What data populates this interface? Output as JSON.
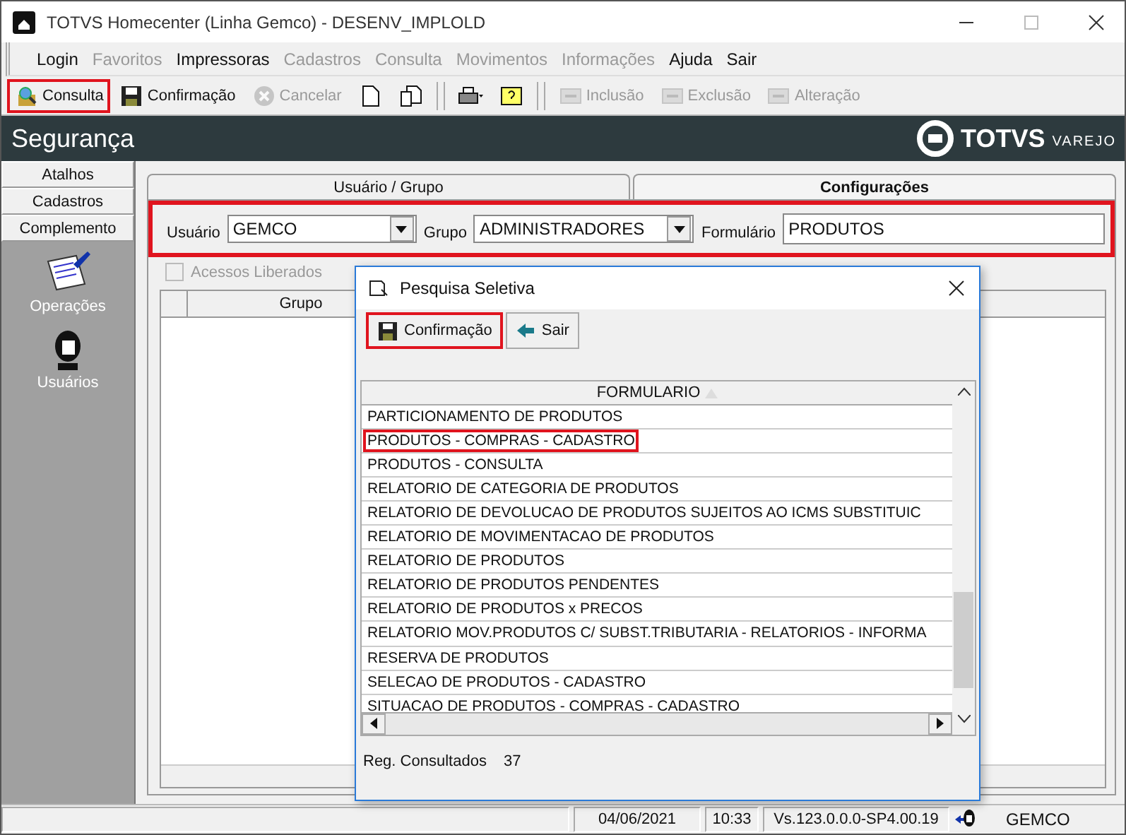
{
  "window": {
    "title": "TOTVS Homecenter (Linha Gemco) - DESENV_IMPLOLD"
  },
  "menu": [
    {
      "label": "Login",
      "disabled": false
    },
    {
      "label": "Favoritos",
      "disabled": true
    },
    {
      "label": "Impressoras",
      "disabled": false
    },
    {
      "label": "Cadastros",
      "disabled": true
    },
    {
      "label": "Consulta",
      "disabled": true
    },
    {
      "label": "Movimentos",
      "disabled": true
    },
    {
      "label": "Informações",
      "disabled": true
    },
    {
      "label": "Ajuda",
      "disabled": false
    },
    {
      "label": "Sair",
      "disabled": false
    }
  ],
  "toolbar": [
    {
      "items": [
        {
          "kind": "search",
          "label": "Consulta",
          "disabled": false,
          "highlighted": true
        },
        {
          "kind": "save",
          "label": "Confirmação",
          "disabled": false,
          "highlighted": false
        },
        {
          "kind": "cancel",
          "label": "Cancelar",
          "disabled": true,
          "highlighted": false
        },
        {
          "kind": "page",
          "disabled": false,
          "highlighted": false
        },
        {
          "kind": "copy",
          "disabled": false,
          "highlighted": false
        }
      ]
    },
    {
      "items": [
        {
          "kind": "print",
          "disabled": false,
          "highlighted": false
        },
        {
          "kind": "help",
          "disabled": false,
          "highlighted": false
        }
      ]
    },
    {
      "items": [
        {
          "kind": "add",
          "label": "Inclusão",
          "disabled": true,
          "highlighted": false
        },
        {
          "kind": "delete",
          "label": "Exclusão",
          "disabled": true,
          "highlighted": false
        },
        {
          "kind": "edit",
          "label": "Alteração",
          "disabled": true,
          "highlighted": false
        }
      ]
    }
  ],
  "header": {
    "title": "Segurança",
    "logo": "TOTVS",
    "logo_sub": "VAREJO"
  },
  "sidebar": {
    "sections": [
      {
        "label": "Atalhos"
      },
      {
        "label": "Cadastros"
      },
      {
        "label": "Complemento"
      }
    ],
    "items": [
      {
        "kind": "operations",
        "label": "Operações"
      },
      {
        "kind": "users",
        "label": "Usuários"
      }
    ]
  },
  "tabs": [
    {
      "label": "Usuário  / Grupo",
      "selected": false
    },
    {
      "label": "Configurações",
      "selected": true
    }
  ],
  "filter": {
    "highlighted": true,
    "fields": [
      {
        "kind": "combo",
        "label": "Usuário",
        "value": "GEMCO"
      },
      {
        "kind": "combo",
        "label": "Grupo",
        "value": "ADMINISTRADORES"
      },
      {
        "kind": "text",
        "label": "Formulário",
        "value": "PRODUTOS"
      }
    ]
  },
  "access_checkbox": {
    "label": "Acessos Liberados",
    "checked": false,
    "disabled": true
  },
  "grid": {
    "columns": [
      "Grupo"
    ]
  },
  "dialog": {
    "title": "Pesquisa Seletiva",
    "buttons": [
      {
        "kind": "save",
        "label": "Confirmação",
        "highlighted": true
      },
      {
        "kind": "back",
        "label": "Sair",
        "highlighted": false
      }
    ],
    "column": "FORMULARIO",
    "rows": [
      {
        "text": "PARTICIONAMENTO DE PRODUTOS",
        "highlighted": false
      },
      {
        "text": "PRODUTOS - COMPRAS - CADASTRO",
        "highlighted": true
      },
      {
        "text": "PRODUTOS - CONSULTA",
        "highlighted": false
      },
      {
        "text": "RELATORIO DE CATEGORIA DE PRODUTOS",
        "highlighted": false
      },
      {
        "text": "RELATORIO DE DEVOLUCAO DE PRODUTOS SUJEITOS AO ICMS SUBSTITUIC",
        "highlighted": false
      },
      {
        "text": "RELATORIO DE MOVIMENTACAO DE PRODUTOS",
        "highlighted": false
      },
      {
        "text": "RELATORIO DE PRODUTOS",
        "highlighted": false
      },
      {
        "text": "RELATORIO DE PRODUTOS PENDENTES",
        "highlighted": false
      },
      {
        "text": "RELATORIO DE PRODUTOS x PRECOS",
        "highlighted": false
      },
      {
        "text": "RELATORIO MOV.PRODUTOS C/ SUBST.TRIBUTARIA - RELATORIOS - INFORMA",
        "highlighted": false
      },
      {
        "text": "RESERVA DE PRODUTOS",
        "highlighted": false
      },
      {
        "text": "SELECAO DE PRODUTOS - CADASTRO",
        "highlighted": false
      },
      {
        "text": "SITUACAO DE PRODUTOS - COMPRAS - CADASTRO",
        "highlighted": false
      }
    ],
    "count_label": "Reg. Consultados",
    "count": "37"
  },
  "status_bar": {
    "date": "04/06/2021",
    "time": "10:33",
    "version": "Vs.123.0.0.0-SP4.00.19",
    "user": "GEMCO"
  }
}
